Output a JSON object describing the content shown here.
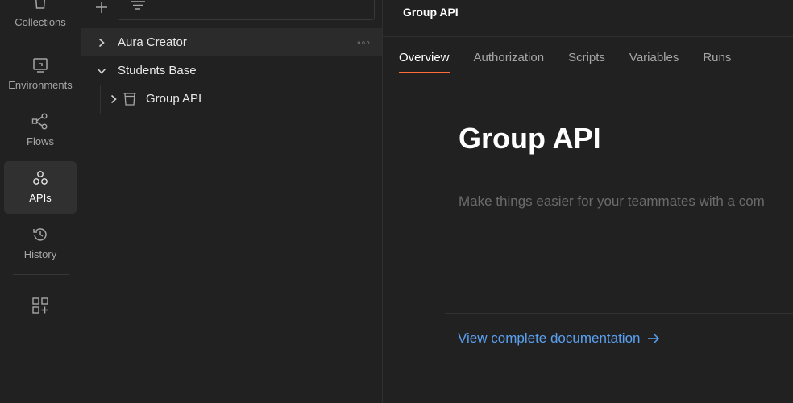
{
  "rail": {
    "items": [
      {
        "label": "Collections",
        "icon": "collections-icon"
      },
      {
        "label": "Environments",
        "icon": "environments-icon"
      },
      {
        "label": "Flows",
        "icon": "flows-icon"
      },
      {
        "label": "APIs",
        "icon": "apis-icon",
        "active": true
      },
      {
        "label": "History",
        "icon": "history-icon"
      }
    ],
    "extra_icon": "add-widget-icon"
  },
  "sidebar": {
    "add_icon": "plus-icon",
    "filter_icon": "filter-icon",
    "more_label": "◦◦◦",
    "tree": [
      {
        "label": "Aura Creator",
        "expanded": false
      },
      {
        "label": "Students Base",
        "expanded": true
      },
      {
        "label": "Group API",
        "expanded": false,
        "icon": "api-bucket-icon"
      }
    ]
  },
  "main": {
    "header_title": "Group API",
    "tabs": [
      {
        "label": "Overview",
        "active": true
      },
      {
        "label": "Authorization"
      },
      {
        "label": "Scripts"
      },
      {
        "label": "Variables"
      },
      {
        "label": "Runs"
      }
    ],
    "doc_title": "Group API",
    "doc_description": "Make things easier for your teammates with a com",
    "doc_link": "View complete documentation"
  },
  "colors": {
    "background": "#212121",
    "active_tab_underline": "#ff6c37",
    "link": "#5aa0f0"
  }
}
